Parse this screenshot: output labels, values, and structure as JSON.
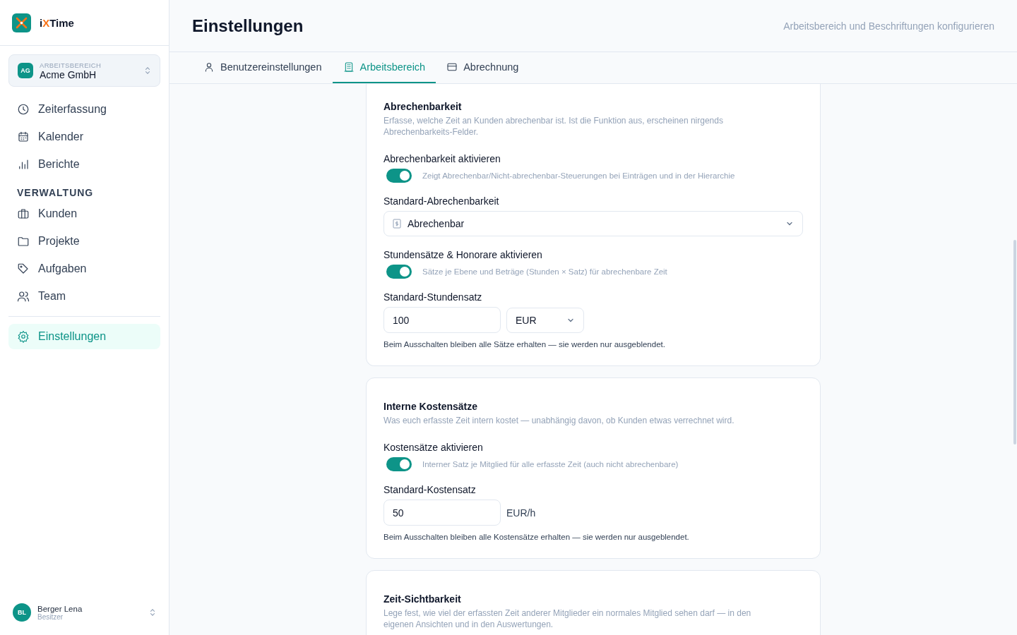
{
  "brand": {
    "parts": [
      {
        "text": "i",
        "accent": false
      },
      {
        "text": "X",
        "accent": true
      },
      {
        "text": "Time",
        "accent": false
      }
    ]
  },
  "workspace": {
    "caption": "ARBEITSBEREICH",
    "name": "Acme GmbH",
    "initials": "AG"
  },
  "nav": [
    {
      "label": "Zeiterfassung",
      "selected": false
    },
    {
      "label": "Kalender",
      "selected": false
    },
    {
      "label": "Berichte",
      "selected": false
    }
  ],
  "admin": {
    "title": "VERWALTUNG",
    "items": [
      {
        "label": "Kunden",
        "selected": false
      },
      {
        "label": "Projekte",
        "selected": false
      },
      {
        "label": "Aufgaben",
        "selected": false
      },
      {
        "label": "Team",
        "selected": false
      }
    ]
  },
  "settings_item": {
    "label": "Einstellungen",
    "selected": true
  },
  "user": {
    "initials": "BL",
    "name": "Berger Lena",
    "role": "Besitzer"
  },
  "header": {
    "title": "Einstellungen",
    "subtitle": "Arbeitsbereich und Beschriftungen konfigurieren"
  },
  "tabs": [
    {
      "label": "Benutzereinstellungen",
      "selected": false
    },
    {
      "label": "Arbeitsbereich",
      "selected": true
    },
    {
      "label": "Abrechnung",
      "selected": false
    }
  ],
  "cards": [
    {
      "title": "Abrechenbarkeit",
      "description": "Erfasse, welche Zeit an Kunden abrechenbar ist. Ist die Funktion aus, erscheinen nirgends Abrechenbarkeits-Felder.",
      "rows": [
        {
          "kind": "toggle",
          "label": "Abrechenbarkeit aktivieren",
          "on": true,
          "hint": "Zeigt Abrechenbar/Nicht-abrechenbar-Steuerungen bei Einträgen und in der Hierarchie"
        },
        {
          "kind": "select",
          "label": "Standard-Abrechenbarkeit",
          "value": "Abrechenbar"
        },
        {
          "kind": "toggle",
          "label": "Stundensätze & Honorare aktivieren",
          "on": true,
          "hint": "Sätze je Ebene und Beträge (Stunden × Satz) für abrechenbare Zeit"
        },
        {
          "kind": "rate",
          "label": "Standard-Stundensatz",
          "value": "100",
          "currency": "EUR"
        },
        {
          "kind": "note",
          "text": "Beim Ausschalten bleiben alle Sätze erhalten — sie werden nur ausgeblendet."
        }
      ]
    },
    {
      "title": "Interne Kostensätze",
      "description": "Was euch erfasste Zeit intern kostet — unabhängig davon, ob Kunden etwas verrechnet wird.",
      "rows": [
        {
          "kind": "toggle",
          "label": "Kostensätze aktivieren",
          "on": true,
          "hint": "Interner Satz je Mitglied für alle erfasste Zeit (auch nicht abrechenbare)"
        },
        {
          "kind": "rate",
          "label": "Standard-Kostensatz",
          "value": "50",
          "unit": "EUR/h"
        },
        {
          "kind": "note",
          "text": "Beim Ausschalten bleiben alle Kostensätze erhalten — sie werden nur ausgeblendet."
        }
      ]
    },
    {
      "title": "Zeit-Sichtbarkeit",
      "description": "Lege fest, wie viel der erfassten Zeit anderer Mitglieder ein normales Mitglied sehen darf — in den eigenen Ansichten und in den Auswertungen."
    }
  ]
}
